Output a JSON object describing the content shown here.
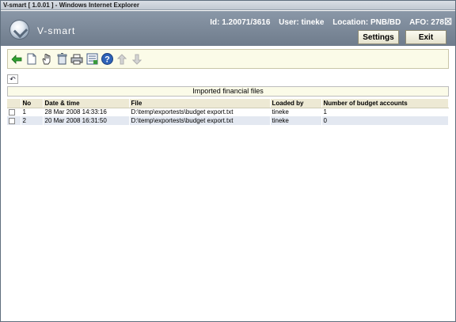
{
  "window": {
    "title": "V-smart [ 1.0.01 ] - Windows Internet Explorer"
  },
  "header": {
    "logo_text": "V-smart",
    "id": "Id: 1.20071/3616",
    "user": "User: tineke",
    "location": "Location: PNB/BD",
    "afo": "AFO: 278",
    "close": "☒",
    "settings_label": "Settings",
    "exit_label": "Exit"
  },
  "toolbar": {
    "icons": [
      "back-arrow-icon",
      "new-document-icon",
      "select-hand-icon",
      "delete-trash-icon",
      "print-icon",
      "list-settings-icon",
      "help-icon",
      "move-up-icon",
      "move-down-icon"
    ]
  },
  "caption": "Imported financial files",
  "table": {
    "columns": [
      "No",
      "Date & time",
      "File",
      "Loaded by",
      "Number of budget accounts"
    ],
    "rows": [
      {
        "no": "1",
        "date": "28 Mar 2008 14:33:16",
        "file": "D:\\temp\\exportests\\budget export.txt",
        "loaded_by": "tineke",
        "count": "1"
      },
      {
        "no": "2",
        "date": "20 Mar 2008 16:31:50",
        "file": "D:\\temp\\exportests\\budget export.txt",
        "loaded_by": "tineke",
        "count": "0"
      }
    ]
  },
  "colors": {
    "accent": "#7a8797",
    "toolbar_bg": "#fbfbe8",
    "header_row": "#ede9d4",
    "alt_row": "#e3e8f1"
  }
}
